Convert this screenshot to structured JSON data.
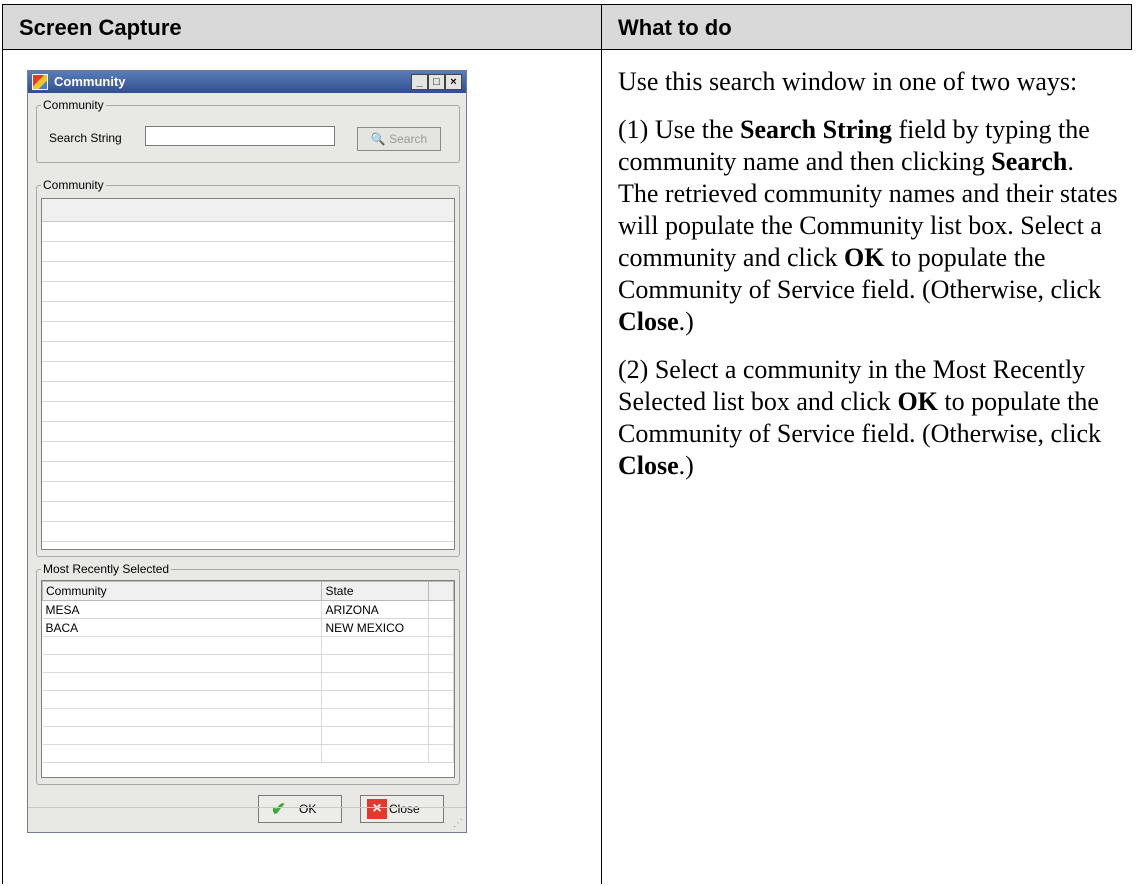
{
  "table": {
    "col1_header": "Screen Capture",
    "col2_header": "What to do"
  },
  "dialog": {
    "title": "Community",
    "minimize": "_",
    "maximize": "□",
    "close": "×",
    "search_group_label": "Community",
    "search_label": "Search String",
    "search_value": "",
    "search_button": "Search",
    "community_group_label": "Community",
    "recent_group_label": "Most Recently Selected",
    "recent_columns": [
      "Community",
      "State"
    ],
    "recent_rows": [
      {
        "community": "MESA",
        "state": "ARIZONA"
      },
      {
        "community": "BACA",
        "state": "NEW MEXICO"
      }
    ],
    "ok_button": "OK",
    "close_button": "Close"
  },
  "instructions": {
    "p1": "Use this search window in one of two ways:",
    "p2_a": "(1) Use the ",
    "p2_b": "Search String",
    "p2_c": " field by typing the community name and then clicking ",
    "p2_d": "Search",
    "p2_e": ". The retrieved community names and their states will populate the Community list box. Select a community and click ",
    "p2_f": "OK",
    "p2_g": " to populate the Community of Service field. (Otherwise, click ",
    "p2_h": "Close",
    "p2_i": ".)",
    "p3_a": "(2) Select a community in the Most Recently Selected list box and click ",
    "p3_b": "OK",
    "p3_c": " to populate the Community of Service field. (Otherwise, click ",
    "p3_d": "Close",
    "p3_e": ".)"
  }
}
